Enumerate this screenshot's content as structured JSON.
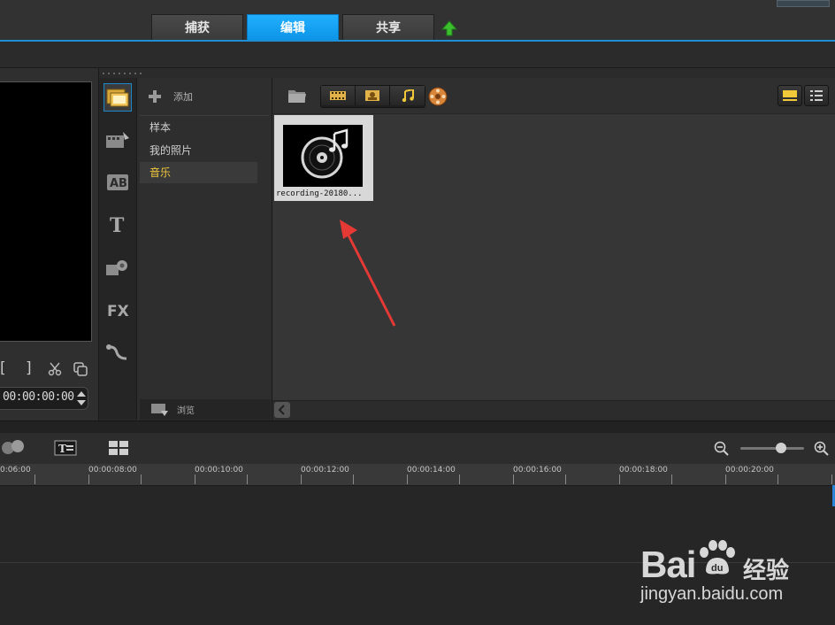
{
  "header": {
    "tabs": [
      {
        "label": "捕获"
      },
      {
        "label": "编辑"
      },
      {
        "label": "共享"
      }
    ],
    "active_tab": "编辑",
    "upload_icon": "green-up-arrow-icon"
  },
  "preview": {
    "controls": [
      "[",
      "]"
    ],
    "timecode": "00:00:00:00"
  },
  "library": {
    "add_label": "添加",
    "folders": [
      {
        "label": "样本"
      },
      {
        "label": "我的照片"
      },
      {
        "label": "音乐"
      }
    ],
    "selected_folder": "音乐",
    "browse_label": "浏览",
    "filters": [
      "video-filter-icon",
      "photo-filter-icon",
      "audio-filter-icon"
    ],
    "media_items": [
      {
        "caption": "recording-20180...",
        "icon": "music-disc-icon"
      }
    ]
  },
  "timeline": {
    "ruler": [
      "0:06:00",
      "00:00:08:00",
      "00:00:10:00",
      "00:00:12:00",
      "00:00:14:00",
      "00:00:16:00",
      "00:00:18:00",
      "00:00:20:00"
    ]
  },
  "watermark": {
    "brand": "Bai",
    "brand_cn": "经验",
    "url": "jingyan.baidu.com"
  },
  "colors": {
    "accent": "#1e8fd6",
    "active_tab": "#16a3f5",
    "selected_folder_text": "#f0c83a",
    "arrow": "#e53935"
  }
}
